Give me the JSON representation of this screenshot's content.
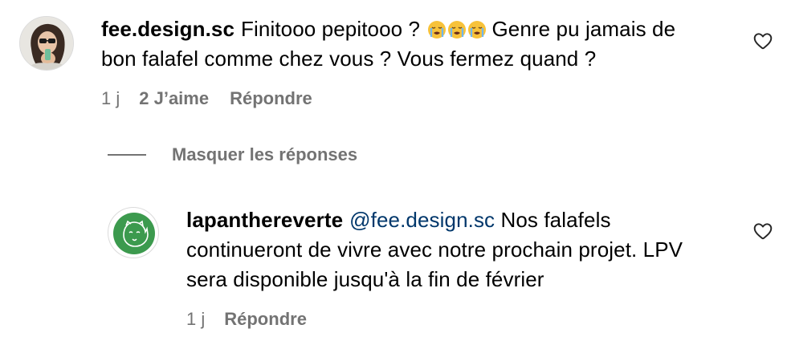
{
  "comment": {
    "username": "fee.design.sc",
    "text_before_emoji": "Finitooo pepitooo ?",
    "emoji": [
      "loudly-crying-face",
      "loudly-crying-face",
      "loudly-crying-face"
    ],
    "text_after_emoji": "Genre pu jamais de bon falafel comme chez vous ? Vous fermez quand ?",
    "time": "1 j",
    "likes": "2 J’aime",
    "reply_label": "Répondre",
    "like_icon": "heart-outline-icon"
  },
  "hide_replies": {
    "label": "Masquer les réponses"
  },
  "reply": {
    "username": "lapanthereverte",
    "mention": "@fee.design.sc",
    "text": "Nos falafels continueront de vivre avec notre prochain projet. LPV sera disponible jusqu'à la fin de février",
    "time": "1 j",
    "reply_label": "Répondre",
    "like_icon": "heart-outline-icon"
  },
  "colors": {
    "text": "#000000",
    "secondary": "#737373",
    "mention": "#00376b",
    "brand_green": "#3c9a4e"
  }
}
